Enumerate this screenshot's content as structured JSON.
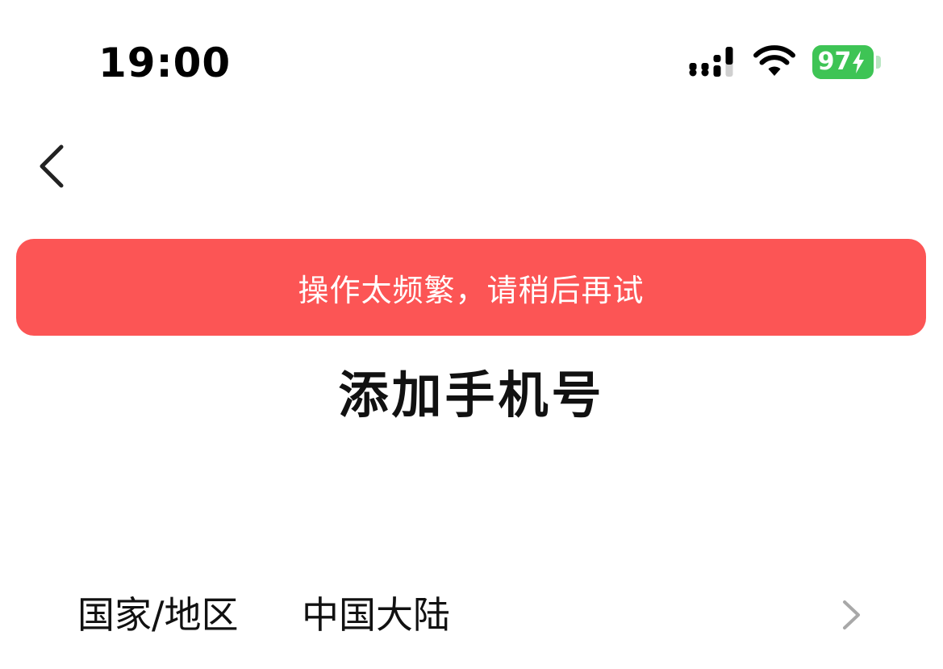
{
  "status_bar": {
    "time": "19:00",
    "battery_level": "97",
    "battery_color": "#3ec455",
    "icons": [
      "signal-icon",
      "wifi-icon",
      "battery-icon",
      "bolt-icon"
    ]
  },
  "nav": {
    "back_icon": "chevron-left-icon"
  },
  "toast": {
    "message": "操作太频繁，请稍后再试",
    "background_color": "#fc5555"
  },
  "page": {
    "title": "添加手机号"
  },
  "region_row": {
    "label": "国家/地区",
    "value": "中国大陆",
    "icon": "chevron-right-icon"
  }
}
